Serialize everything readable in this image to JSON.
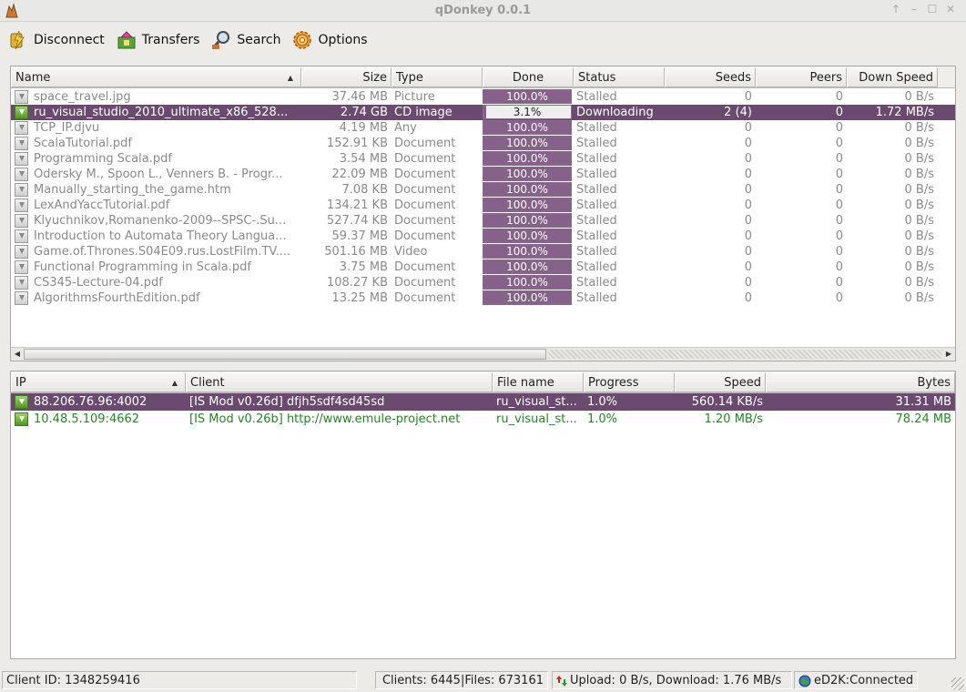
{
  "window": {
    "title": "qDonkey 0.0.1"
  },
  "toolbar": [
    {
      "label": "Disconnect",
      "icon": "disconnect-icon"
    },
    {
      "label": "Transfers",
      "icon": "transfers-icon"
    },
    {
      "label": "Search",
      "icon": "search-icon"
    },
    {
      "label": "Options",
      "icon": "options-icon"
    }
  ],
  "transfers": {
    "columns": [
      "Name",
      "Size",
      "Type",
      "Done",
      "Status",
      "Seeds",
      "Peers",
      "Down Speed"
    ],
    "rows": [
      {
        "name": "space_travel.jpg",
        "size": "37.46 MB",
        "type": "Picture",
        "done": "100.0%",
        "progress": 1.0,
        "status": "Stalled",
        "seeds": "0",
        "peers": "0",
        "speed": "0 B/s",
        "selected": false
      },
      {
        "name": "ru_visual_studio_2010_ultimate_x86_528...",
        "size": "2.74 GB",
        "type": "CD image",
        "done": "3.1%",
        "progress": 0.031,
        "status": "Downloading",
        "seeds": "2 (4)",
        "peers": "0",
        "speed": "1.72 MB/s",
        "selected": true
      },
      {
        "name": "TCP_IP.djvu",
        "size": "4.19 MB",
        "type": "Any",
        "done": "100.0%",
        "progress": 1.0,
        "status": "Stalled",
        "seeds": "0",
        "peers": "0",
        "speed": "0 B/s",
        "selected": false
      },
      {
        "name": "ScalaTutorial.pdf",
        "size": "152.91 KB",
        "type": "Document",
        "done": "100.0%",
        "progress": 1.0,
        "status": "Stalled",
        "seeds": "0",
        "peers": "0",
        "speed": "0 B/s",
        "selected": false
      },
      {
        "name": "Programming Scala.pdf",
        "size": "3.54 MB",
        "type": "Document",
        "done": "100.0%",
        "progress": 1.0,
        "status": "Stalled",
        "seeds": "0",
        "peers": "0",
        "speed": "0 B/s",
        "selected": false
      },
      {
        "name": "Odersky M., Spoon L., Venners B. - Progr...",
        "size": "22.09 MB",
        "type": "Document",
        "done": "100.0%",
        "progress": 1.0,
        "status": "Stalled",
        "seeds": "0",
        "peers": "0",
        "speed": "0 B/s",
        "selected": false
      },
      {
        "name": "Manually_starting_the_game.htm",
        "size": "7.08 KB",
        "type": "Document",
        "done": "100.0%",
        "progress": 1.0,
        "status": "Stalled",
        "seeds": "0",
        "peers": "0",
        "speed": "0 B/s",
        "selected": false
      },
      {
        "name": "LexAndYaccTutorial.pdf",
        "size": "134.21 KB",
        "type": "Document",
        "done": "100.0%",
        "progress": 1.0,
        "status": "Stalled",
        "seeds": "0",
        "peers": "0",
        "speed": "0 B/s",
        "selected": false
      },
      {
        "name": "Klyuchnikov,Romanenko-2009--SPSC-.Su...",
        "size": "527.74 KB",
        "type": "Document",
        "done": "100.0%",
        "progress": 1.0,
        "status": "Stalled",
        "seeds": "0",
        "peers": "0",
        "speed": "0 B/s",
        "selected": false
      },
      {
        "name": "Introduction to Automata Theory Langua...",
        "size": "59.37 MB",
        "type": "Document",
        "done": "100.0%",
        "progress": 1.0,
        "status": "Stalled",
        "seeds": "0",
        "peers": "0",
        "speed": "0 B/s",
        "selected": false
      },
      {
        "name": "Game.of.Thrones.S04E09.rus.LostFilm.TV....",
        "size": "501.16 MB",
        "type": "Video",
        "done": "100.0%",
        "progress": 1.0,
        "status": "Stalled",
        "seeds": "0",
        "peers": "0",
        "speed": "0 B/s",
        "selected": false
      },
      {
        "name": "Functional Programming in Scala.pdf",
        "size": "3.75 MB",
        "type": "Document",
        "done": "100.0%",
        "progress": 1.0,
        "status": "Stalled",
        "seeds": "0",
        "peers": "0",
        "speed": "0 B/s",
        "selected": false
      },
      {
        "name": "CS345-Lecture-04.pdf",
        "size": "108.27 KB",
        "type": "Document",
        "done": "100.0%",
        "progress": 1.0,
        "status": "Stalled",
        "seeds": "0",
        "peers": "0",
        "speed": "0 B/s",
        "selected": false
      },
      {
        "name": "AlgorithmsFourthEdition.pdf",
        "size": "13.25 MB",
        "type": "Document",
        "done": "100.0%",
        "progress": 1.0,
        "status": "Stalled",
        "seeds": "0",
        "peers": "0",
        "speed": "0 B/s",
        "selected": false
      }
    ]
  },
  "peers": {
    "columns": [
      "IP",
      "Client",
      "File name",
      "Progress",
      "Speed",
      "Bytes"
    ],
    "rows": [
      {
        "ip": "88.206.76.96:4002",
        "client": "[IS Mod v0.26d] dfjh5sdf4sd45sd",
        "file": "ru_visual_st...",
        "progress": "1.0%",
        "speed": "560.14 KB/s",
        "bytes": "31.31 MB",
        "selected": true
      },
      {
        "ip": "10.48.5.109:4662",
        "client": "[IS Mod v0.26b] http://www.emule-project.net",
        "file": "ru_visual_st...",
        "progress": "1.0%",
        "speed": "1.20 MB/s",
        "bytes": "78.24 MB",
        "selected": false
      }
    ]
  },
  "statusbar": {
    "client_id": "Client ID: 1348259416",
    "clients_files": "Clients: 6445|Files: 673161",
    "rates": "Upload: 0 B/s, Download: 1.76 MB/s",
    "network": "eD2K:Connected"
  },
  "colors": {
    "selection": "#6a4a6e",
    "progress_fill": "#86618a",
    "peer_text": "#1f8a1f"
  }
}
